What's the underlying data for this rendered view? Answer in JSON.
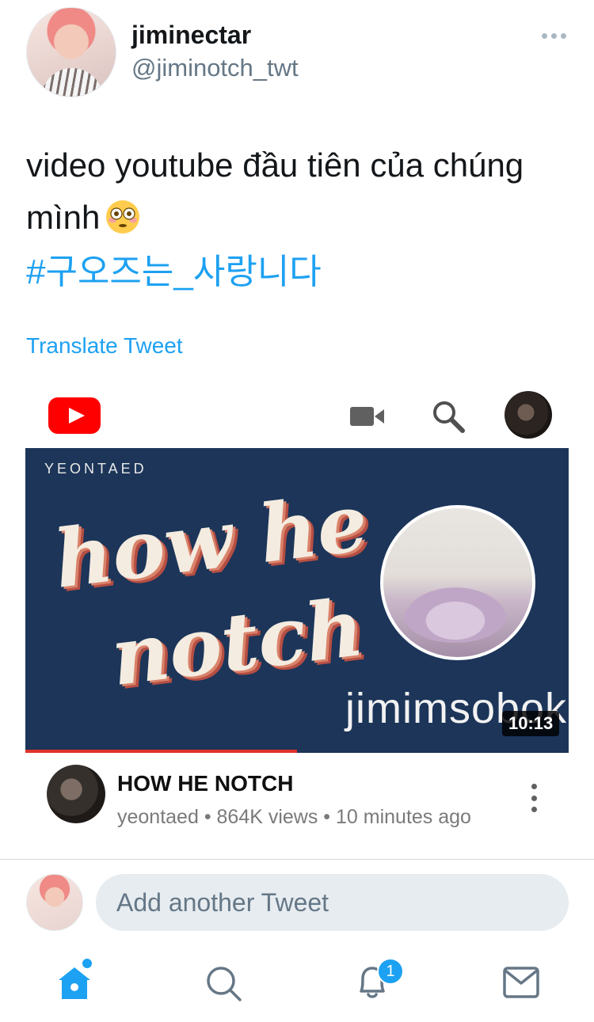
{
  "tweet": {
    "author": {
      "display_name": "jiminectar",
      "handle": "@jiminotch_twt"
    },
    "text": "video youtube đầu tiên của chúng mình",
    "emoji": "flushed-face-emoji",
    "hashtag": "#구오즈는_사랑니다",
    "translate_label": "Translate Tweet"
  },
  "youtube_card": {
    "thumbnail": {
      "channel_label": "YEONTAED",
      "title_line1": "how he",
      "title_line2": "notch",
      "watermark": "jimimsobok",
      "duration": "10:13",
      "watched_fraction": 0.5
    },
    "video": {
      "title": "HOW HE NOTCH",
      "meta": "yeontaed • 864K views • 10 minutes ago"
    },
    "colors": {
      "brand_red": "#ff0000",
      "progress": "#e0322a",
      "thumb_bg": "#1c3559"
    }
  },
  "composer": {
    "placeholder": "Add another Tweet"
  },
  "bottom_nav": {
    "items": [
      "home-icon",
      "search-icon",
      "notifications-icon",
      "messages-icon"
    ],
    "notification_count": "1"
  },
  "colors": {
    "accent": "#1da1f2",
    "text_secondary": "#657786"
  }
}
